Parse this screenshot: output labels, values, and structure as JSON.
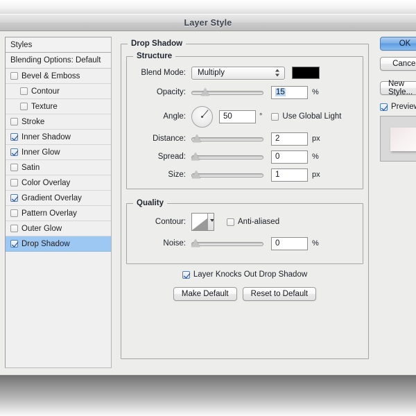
{
  "window": {
    "title": "Layer Style"
  },
  "styles_panel": {
    "header": "Styles",
    "blending_options": "Blending Options: Default",
    "effects": [
      {
        "label": "Bevel & Emboss",
        "checked": false,
        "indent": false,
        "selected": false
      },
      {
        "label": "Contour",
        "checked": false,
        "indent": true,
        "selected": false
      },
      {
        "label": "Texture",
        "checked": false,
        "indent": true,
        "selected": false
      },
      {
        "label": "Stroke",
        "checked": false,
        "indent": false,
        "selected": false
      },
      {
        "label": "Inner Shadow",
        "checked": true,
        "indent": false,
        "selected": false
      },
      {
        "label": "Inner Glow",
        "checked": true,
        "indent": false,
        "selected": false
      },
      {
        "label": "Satin",
        "checked": false,
        "indent": false,
        "selected": false
      },
      {
        "label": "Color Overlay",
        "checked": false,
        "indent": false,
        "selected": false
      },
      {
        "label": "Gradient Overlay",
        "checked": true,
        "indent": false,
        "selected": false
      },
      {
        "label": "Pattern Overlay",
        "checked": false,
        "indent": false,
        "selected": false
      },
      {
        "label": "Outer Glow",
        "checked": false,
        "indent": false,
        "selected": false
      },
      {
        "label": "Drop Shadow",
        "checked": true,
        "indent": false,
        "selected": true
      }
    ]
  },
  "drop_shadow": {
    "legend": "Drop Shadow",
    "structure": {
      "legend": "Structure",
      "blend_mode_label": "Blend Mode:",
      "blend_mode_value": "Multiply",
      "shadow_color": "#000000",
      "opacity_label": "Opacity:",
      "opacity_value": "15",
      "opacity_unit": "%",
      "opacity_percent": 15,
      "angle_label": "Angle:",
      "angle_value": "50",
      "angle_unit": "°",
      "angle_degrees": 50,
      "use_global_light_label": "Use Global Light",
      "use_global_light_checked": false,
      "distance_label": "Distance:",
      "distance_value": "2",
      "distance_unit": "px",
      "distance_percent": 2,
      "spread_label": "Spread:",
      "spread_value": "0",
      "spread_unit": "%",
      "spread_percent": 0,
      "size_label": "Size:",
      "size_value": "1",
      "size_unit": "px",
      "size_percent": 1
    },
    "quality": {
      "legend": "Quality",
      "contour_label": "Contour:",
      "anti_aliased_label": "Anti-aliased",
      "anti_aliased_checked": false,
      "noise_label": "Noise:",
      "noise_value": "0",
      "noise_unit": "%",
      "noise_percent": 0
    },
    "knockout_label": "Layer Knocks Out Drop Shadow",
    "knockout_checked": true,
    "make_default_label": "Make Default",
    "reset_to_default_label": "Reset to Default"
  },
  "actions": {
    "ok_label": "OK",
    "cancel_label": "Cancel",
    "new_style_label": "New Style...",
    "preview_label": "Preview",
    "preview_checked": true
  },
  "colors": {
    "selection_blue": "#9dc8f4",
    "dialog_bg": "#ededec",
    "panel_bg": "#f0f0f0",
    "border": "#a5a5a5",
    "text": "#1b1f26"
  }
}
